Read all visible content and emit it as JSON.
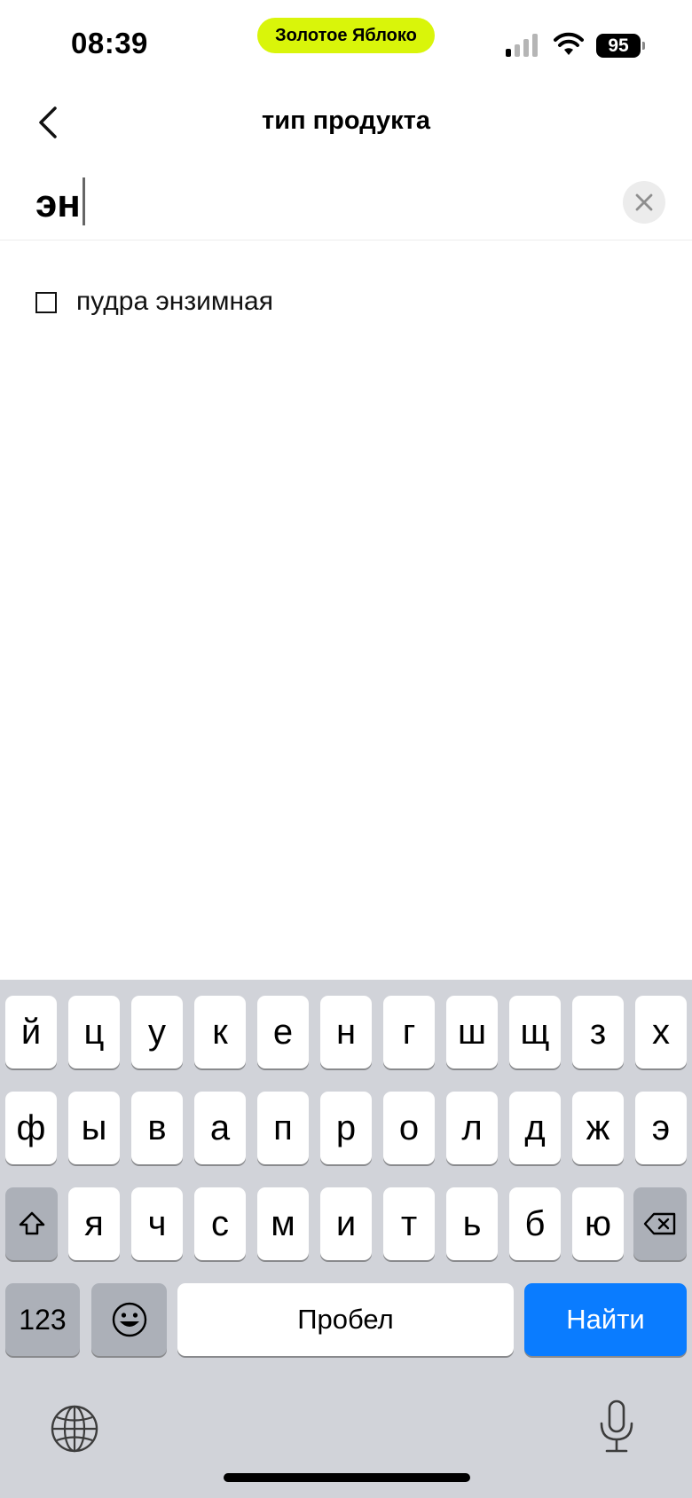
{
  "status_bar": {
    "time": "08:39",
    "carrier_pill": "Золотое Яблоко",
    "battery": "95"
  },
  "header": {
    "title": "тип продукта"
  },
  "search": {
    "value": "эн"
  },
  "results": [
    {
      "label": "пудра энзимная",
      "checked": false
    }
  ],
  "keyboard": {
    "row1": [
      "й",
      "ц",
      "у",
      "к",
      "е",
      "н",
      "г",
      "ш",
      "щ",
      "з",
      "х"
    ],
    "row2": [
      "ф",
      "ы",
      "в",
      "а",
      "п",
      "р",
      "о",
      "л",
      "д",
      "ж",
      "э"
    ],
    "row3": [
      "я",
      "ч",
      "с",
      "м",
      "и",
      "т",
      "ь",
      "б",
      "ю"
    ],
    "numbers_label": "123",
    "space_label": "Пробел",
    "action_label": "Найти"
  },
  "colors": {
    "accent_pill": "#d9f50a",
    "action_key": "#0a7cff",
    "keyboard_bg": "#d1d3d9"
  }
}
